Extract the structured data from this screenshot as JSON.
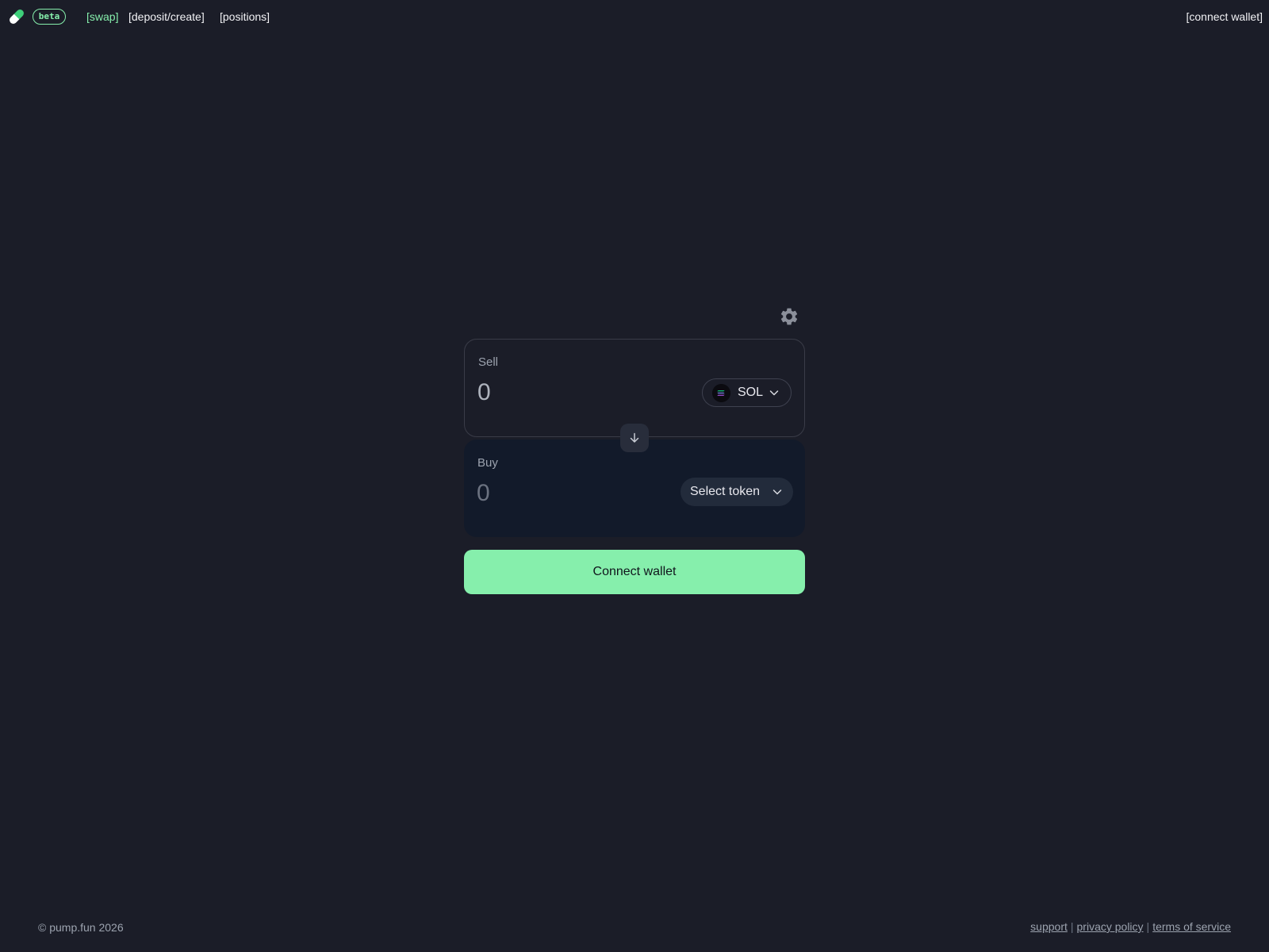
{
  "header": {
    "beta_label": "beta",
    "nav": {
      "swap": "[swap]",
      "deposit": "[deposit/create]",
      "positions": "[positions]"
    },
    "connect_wallet": "[connect wallet]"
  },
  "swap": {
    "sell": {
      "label": "Sell",
      "amount_placeholder": "0",
      "token": "SOL"
    },
    "buy": {
      "label": "Buy",
      "amount_placeholder": "0",
      "token_button": "Select token"
    },
    "connect_button": "Connect wallet"
  },
  "footer": {
    "copyright": "© pump.fun 2026",
    "links": {
      "support": "support",
      "privacy": "privacy policy",
      "terms": "terms of service"
    },
    "separator": "|"
  },
  "colors": {
    "background": "#1b1d28",
    "accent": "#86efac",
    "buy_panel": "#121a2a"
  },
  "icons": {
    "logo": "pill-icon",
    "settings": "gear-icon",
    "token": "solana-icon",
    "dropdown": "chevron-down-icon",
    "swap_direction": "arrow-down-icon"
  }
}
